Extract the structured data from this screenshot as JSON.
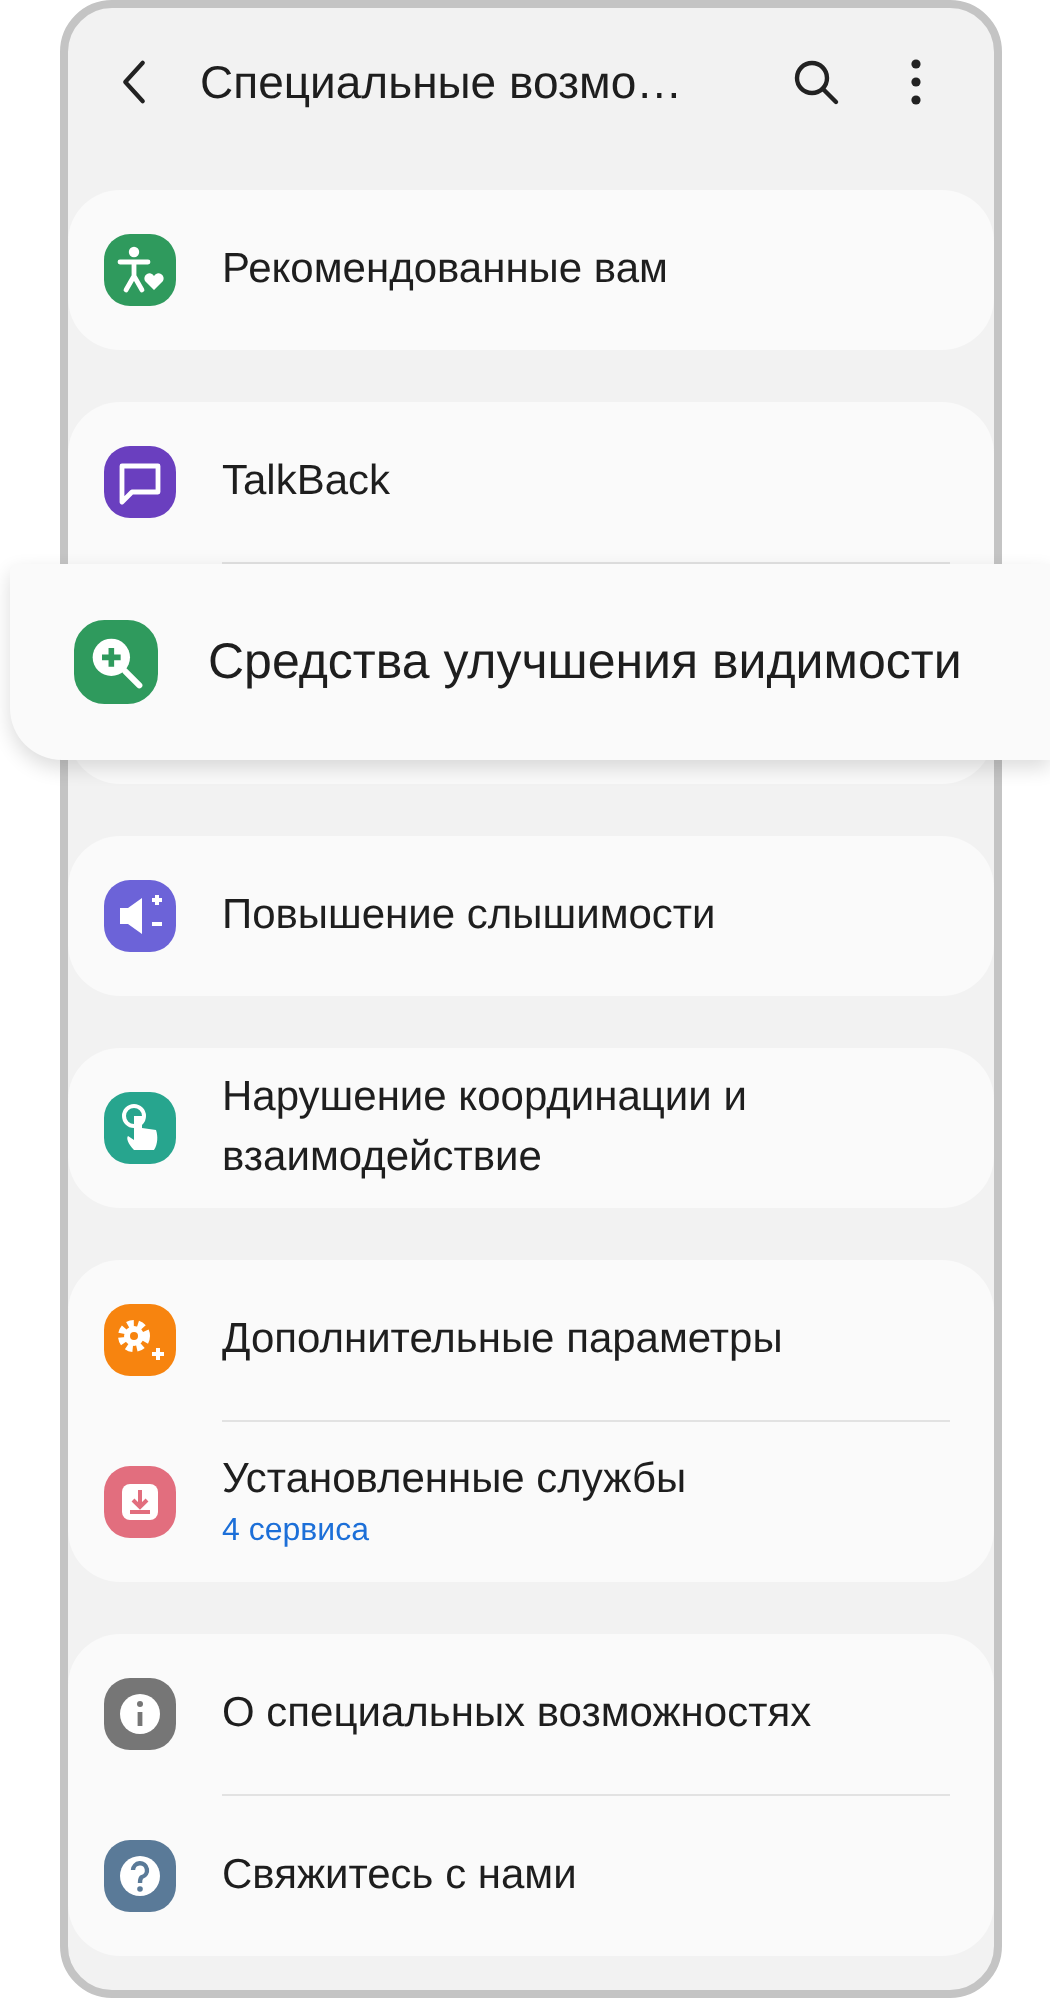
{
  "header": {
    "title": "Специальные возмо…"
  },
  "groups": [
    {
      "items": [
        {
          "label": "Рекомендованные вам",
          "color": "#2f9a5d",
          "highlighted": false
        }
      ]
    },
    {
      "items": [
        {
          "label": "TalkBack",
          "color": "#6a3fbf",
          "highlighted": false
        },
        {
          "label": "Средства улучшения видимости",
          "color": "#2f9a5d",
          "highlighted": true
        }
      ]
    },
    {
      "items": [
        {
          "label": "Повышение слышимости",
          "color": "#6c63d8",
          "highlighted": false
        }
      ]
    },
    {
      "items": [
        {
          "label": "Нарушение координации и взаимодействие",
          "color": "#27a58e",
          "highlighted": false
        }
      ]
    },
    {
      "items": [
        {
          "label": "Дополнительные параметры",
          "color": "#f7840f",
          "highlighted": false
        },
        {
          "label": "Установленные службы",
          "sublabel": "4 сервиса",
          "color": "#e26e7e",
          "highlighted": false
        }
      ]
    },
    {
      "items": [
        {
          "label": "О специальных возможностях",
          "color": "#767676",
          "highlighted": false
        },
        {
          "label": "Свяжитесь с нами",
          "color": "#5a7a98",
          "highlighted": false
        }
      ]
    }
  ]
}
